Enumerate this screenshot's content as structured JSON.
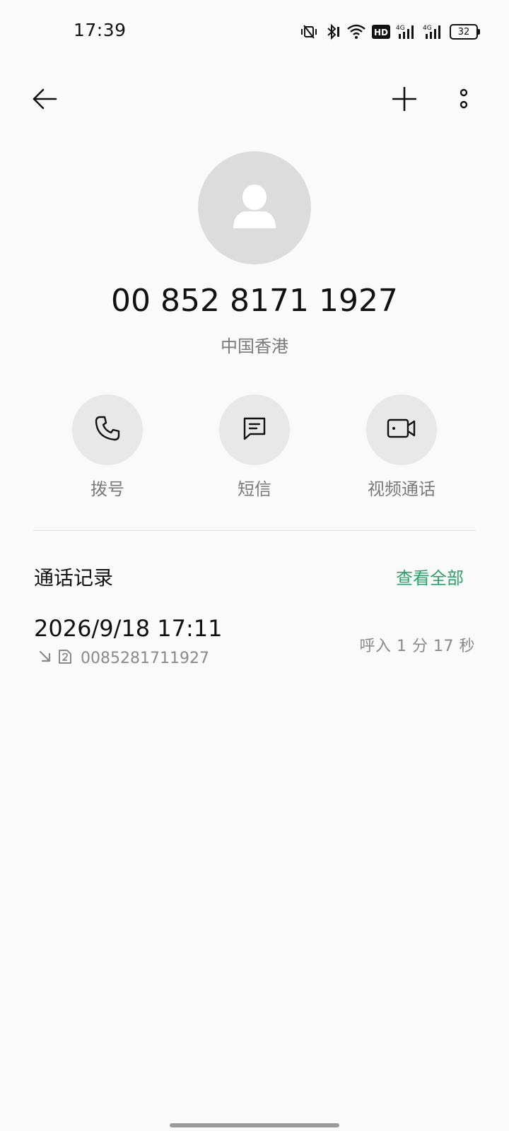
{
  "status_bar": {
    "time": "17:39",
    "icons": [
      "vibrate-mute-icon",
      "bluetooth-icon",
      "wifi-icon",
      "hd-icon",
      "signal-4g-icon",
      "signal-4g-icon"
    ],
    "network_1": "4G",
    "network_2": "4G",
    "hd_label": "HD",
    "battery": "32"
  },
  "header": {
    "back_icon": "back-arrow-icon",
    "add_icon": "plus-icon",
    "more_icon": "more-vertical-icon"
  },
  "contact": {
    "avatar_icon": "person-icon",
    "phone_number": "00 852 8171 1927",
    "region": "中国香港"
  },
  "actions": [
    {
      "label": "拨号",
      "icon": "phone-icon"
    },
    {
      "label": "短信",
      "icon": "message-icon"
    },
    {
      "label": "视频通话",
      "icon": "video-icon"
    }
  ],
  "call_log": {
    "title": "通话记录",
    "view_all": "查看全部",
    "records": [
      {
        "datetime": "2026/9/18 17:11",
        "direction_icon": "incoming-arrow-icon",
        "sim_icon": "sim-2-icon",
        "number": "0085281711927",
        "type_duration": "呼入  1 分 17 秒"
      }
    ]
  },
  "colors": {
    "background": "#fafafa",
    "accent": "#2aa36b",
    "secondary_text": "#7a7a7a",
    "circle_bg": "#e8e8e8",
    "avatar_bg": "#dcdcdc"
  }
}
